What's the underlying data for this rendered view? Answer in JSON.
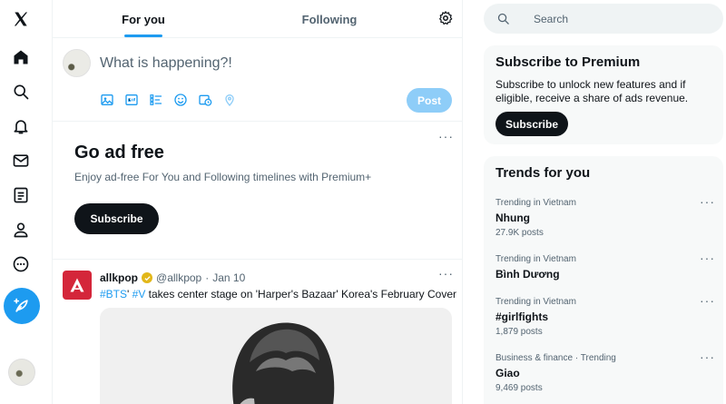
{
  "nav": {
    "items": [
      {
        "name": "x-logo",
        "icon": "x-logo-icon"
      },
      {
        "name": "home",
        "icon": "home-icon"
      },
      {
        "name": "explore",
        "icon": "search-icon"
      },
      {
        "name": "notifications",
        "icon": "bell-icon"
      },
      {
        "name": "messages",
        "icon": "mail-icon"
      },
      {
        "name": "lists",
        "icon": "list-icon"
      },
      {
        "name": "profile",
        "icon": "person-icon"
      },
      {
        "name": "more",
        "icon": "more-circle-icon"
      }
    ],
    "compose_icon": "feather-plus-icon"
  },
  "tabs": {
    "for_you": "For you",
    "following": "Following",
    "settings_icon": "gear-icon"
  },
  "composer": {
    "placeholder": "What is happening?!",
    "post_label": "Post",
    "tools": [
      "image-icon",
      "gif-icon",
      "poll-icon",
      "emoji-icon",
      "schedule-icon",
      "location-icon"
    ]
  },
  "ad_free": {
    "title": "Go ad free",
    "text": "Enjoy ad-free For You and Following timelines with Premium+",
    "button": "Subscribe",
    "more": "···"
  },
  "tweet": {
    "name": "allkpop",
    "handle": "@allkpop",
    "dot": "·",
    "date": "Jan 10",
    "hashtag1": "#BTS",
    "separator": "' ",
    "hashtag2": "#V",
    "text": " takes center stage on 'Harper's Bazaar' Korea's February Cover",
    "more": "···"
  },
  "search": {
    "placeholder": "Search"
  },
  "premium": {
    "title": "Subscribe to Premium",
    "text": "Subscribe to unlock new features and if eligible, receive a share of ads revenue.",
    "button": "Subscribe"
  },
  "trends": {
    "title": "Trends for you",
    "items": [
      {
        "context": "Trending in Vietnam",
        "name": "Nhung",
        "count": "27.9K posts"
      },
      {
        "context": "Trending in Vietnam",
        "name": "Bình Dương",
        "count": ""
      },
      {
        "context": "Trending in Vietnam",
        "name": "#girlfights",
        "count": "1,879 posts"
      },
      {
        "context": "Business & finance · Trending",
        "name": "Giao",
        "count": "9,469 posts"
      }
    ],
    "more": "···"
  },
  "colors": {
    "accent": "#1d9bf0",
    "post_disabled": "#8ecdf8",
    "dark": "#0f1419",
    "muted": "#536471",
    "panel": "#f7f9f9",
    "avatar_red": "#d4263a",
    "verified_gold": "#e2b719"
  }
}
